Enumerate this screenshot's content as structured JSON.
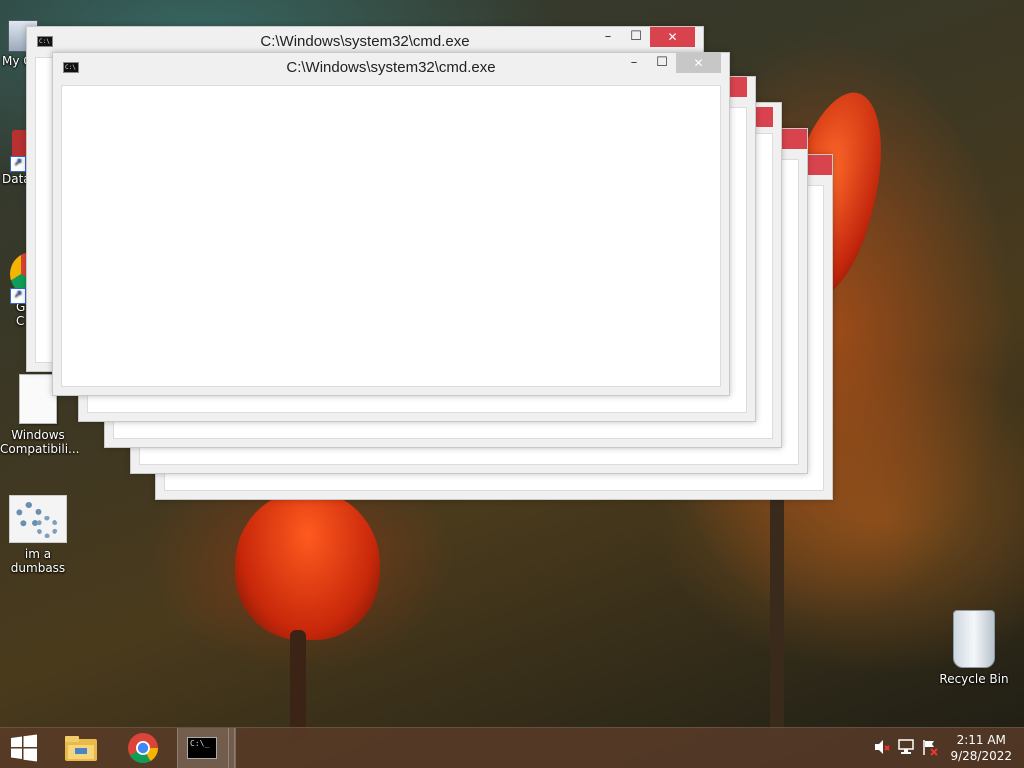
{
  "desktop": {
    "icons": [
      {
        "label": "My C",
        "icon": "computer-icon"
      },
      {
        "label": "Data",
        "icon": "data-shortcut-icon"
      },
      {
        "label": "G\nC",
        "icon": "chrome-shortcut-icon"
      },
      {
        "label": "Windows Compatibili...",
        "icon": "document-icon"
      },
      {
        "label": "im a dumbass",
        "icon": "gears-icon"
      },
      {
        "label": "Recycle Bin",
        "icon": "recycle-bin-icon"
      }
    ]
  },
  "windows": [
    {
      "title": "C:\\Windows\\system32\\cmd.exe",
      "close_label": "✕",
      "min_label": "–",
      "max_label": "☐"
    },
    {
      "title": "C:\\Windows\\system32\\cmd.exe",
      "close_label": "✕",
      "min_label": "–",
      "max_label": "☐"
    }
  ],
  "taskbar": {
    "start_icon": "windows-logo-icon",
    "pinned": [
      "file-explorer-icon",
      "chrome-icon",
      "cmd-icon"
    ],
    "clock": {
      "time": "2:11 AM",
      "date": "9/28/2022"
    },
    "tray_icons": [
      "speaker-muted-icon",
      "network-icon",
      "action-center-flag-icon"
    ]
  },
  "colors": {
    "close": "#d9434e",
    "taskbar": "#5a3c28"
  }
}
